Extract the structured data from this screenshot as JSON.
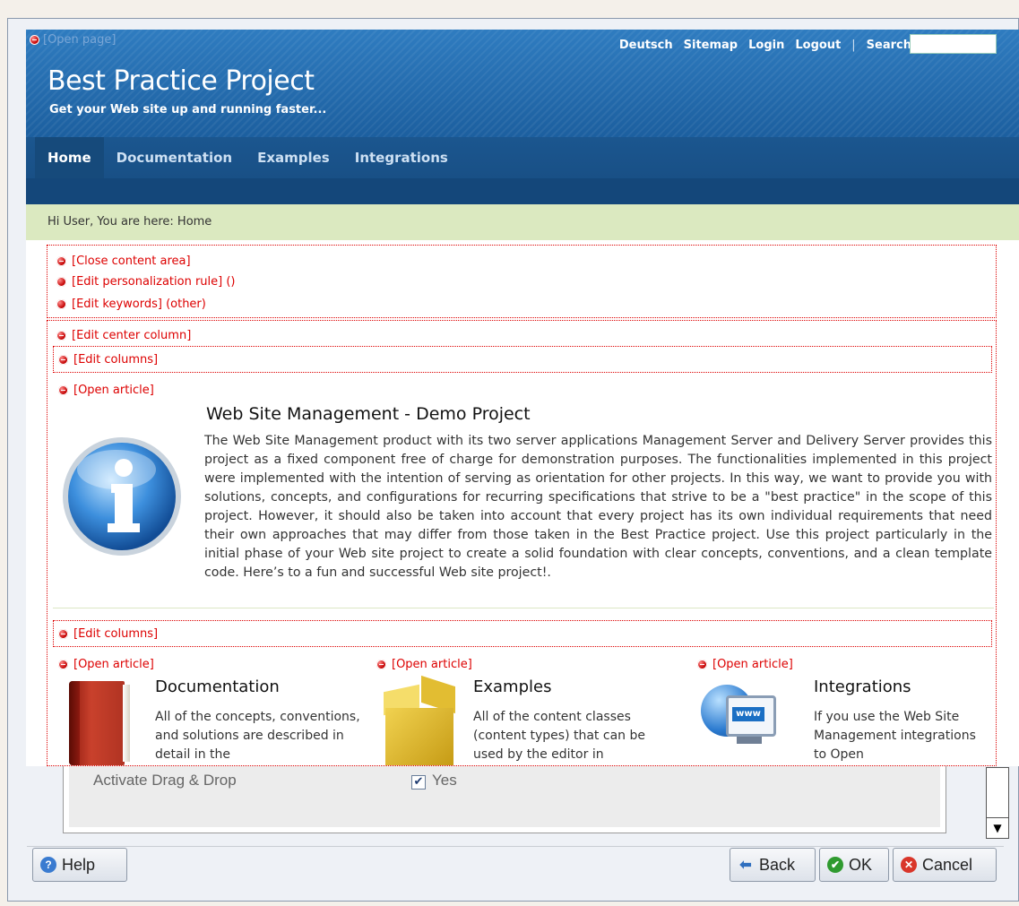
{
  "overlay": {
    "open_page": "[Open page]",
    "top_links": [
      "Deutsch",
      "Sitemap",
      "Login",
      "Logout",
      "|",
      "Search"
    ],
    "site_title": "Best Practice Project",
    "site_tagline": "Get your Web site up and running faster...",
    "nav_tabs": [
      "Home",
      "Documentation",
      "Examples",
      "Integrations"
    ],
    "breadcrumb": "Hi User, You are here:  Home",
    "controls": {
      "close_content_area": "[Close content area]",
      "edit_personalization_rule": "[Edit personalization rule] ()",
      "edit_keywords": "[Edit keywords] (other)",
      "edit_center_column": "[Edit center column]",
      "edit_columns": "[Edit columns]",
      "open_article": "[Open article]"
    },
    "main_article": {
      "title": "Web Site Management - Demo Project",
      "body": "The Web Site Management product with its two server applications Management Server and Delivery Server provides this project as a fixed component free of charge for demonstration purposes. The functionalities implemented in this project were implemented with the intention of serving as orientation for other projects. In this way, we want to provide you with solutions, concepts, and configurations for recurring specifications that strive to be a \"best practice\" in the scope of this project. However, it should also be taken into account that every project has its own individual requirements that need their own approaches that may differ from those taken in the Best Practice project. Use this project particularly in the initial phase of your Web site project to create a solid foundation with clear concepts, conventions, and a clean template code. Here’s to a fun and successful Web site project!."
    },
    "columns": [
      {
        "title": "Documentation",
        "desc": "All of the concepts, conventions, and solutions are described in detail in the",
        "icon": "book-icon"
      },
      {
        "title": "Examples",
        "desc": "All of the content classes (content types) that can be used by the editor in",
        "icon": "box-icon"
      },
      {
        "title": "Integrations",
        "desc": "If you use the Web Site Management integrations to Open",
        "icon": "www-icon"
      }
    ]
  },
  "dialog": {
    "dnd_label": "Activate Drag & Drop",
    "dnd_value": "Yes",
    "buttons": {
      "help": "Help",
      "back": "Back",
      "ok": "OK",
      "cancel": "Cancel"
    }
  },
  "colors": {
    "header_blue": "#1c5f9f",
    "breadcrumb_green": "#dbe9c0",
    "edit_red": "#dd0000"
  }
}
